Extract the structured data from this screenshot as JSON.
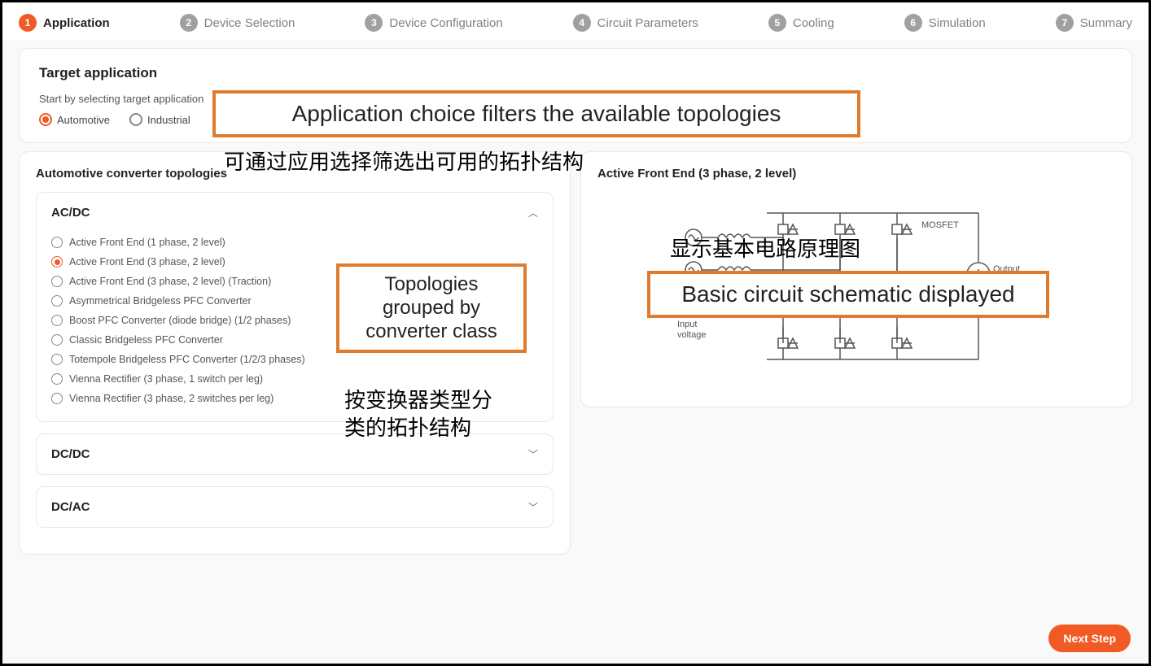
{
  "stepper": {
    "steps": [
      {
        "num": "1",
        "label": "Application",
        "active": true
      },
      {
        "num": "2",
        "label": "Device Selection"
      },
      {
        "num": "3",
        "label": "Device Configuration"
      },
      {
        "num": "4",
        "label": "Circuit Parameters"
      },
      {
        "num": "5",
        "label": "Cooling"
      },
      {
        "num": "6",
        "label": "Simulation"
      },
      {
        "num": "7",
        "label": "Summary"
      }
    ]
  },
  "target": {
    "title": "Target application",
    "subtitle": "Start by selecting target application",
    "options": {
      "automotive": "Automotive",
      "industrial": "Industrial"
    }
  },
  "annotations": {
    "a1": "Application choice filters the available topologies",
    "a1_cn": "可通过应用选择筛选出可用的拓扑结构",
    "a2_l1": "Topologies",
    "a2_l2": "grouped by",
    "a2_l3": "converter class",
    "a2_cn_l1": "按变换器类型分",
    "a2_cn_l2": "类的拓扑结构",
    "a3": "Basic circuit schematic displayed",
    "a3_cn": "显示基本电路原理图"
  },
  "left": {
    "title": "Automotive converter topologies",
    "sections": {
      "acdc": {
        "title": "AC/DC",
        "items": [
          "Active Front End (1 phase, 2 level)",
          "Active Front End (3 phase, 2 level)",
          "Active Front End (3 phase, 2 level) (Traction)",
          "Asymmetrical Bridgeless PFC Converter",
          "Boost PFC Converter (diode bridge) (1/2 phases)",
          "Classic Bridgeless PFC Converter",
          "Totempole Bridgeless PFC Converter (1/2/3 phases)",
          "Vienna Rectifier (3 phase, 1 switch per leg)",
          "Vienna Rectifier (3 phase, 2 switches per leg)"
        ]
      },
      "dcdc": {
        "title": "DC/DC"
      },
      "dcac": {
        "title": "DC/AC"
      }
    }
  },
  "right": {
    "title": "Active Front End (3 phase, 2 level)",
    "schematic": {
      "mosfet": "MOSFET",
      "input": "Input\nvoltage",
      "output": "Output\nvoltage"
    }
  },
  "next": "Next Step"
}
